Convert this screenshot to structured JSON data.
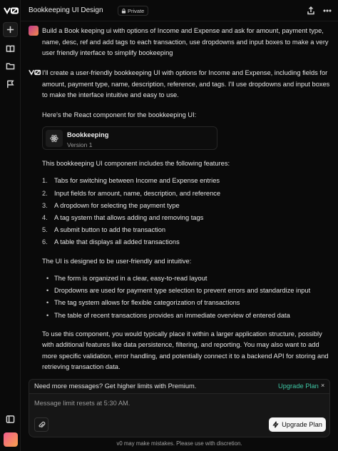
{
  "header": {
    "title": "Bookkeeping UI Design",
    "visibility": "Private"
  },
  "rail": {
    "logo": "v0",
    "icons": [
      "plus-icon",
      "book-icon",
      "folder-icon",
      "flag-icon",
      "sidebar-icon"
    ]
  },
  "conversation": {
    "user_message": "Build a Book keeping ui with options of Income and Expense and ask for amount, payment type, name, desc, ref and add tags to each transaction, use dropdowns and input boxes to make a very user friendly interface to simplify bookeeping",
    "assistant": {
      "intro": "I'll create a user-friendly bookkeeping UI with options for Income and Expense, including fields for amount, payment type, name, description, reference, and tags. I'll use dropdowns and input boxes to make the interface intuitive and easy to use.",
      "component_intro": "Here's the React component for the bookkeeping UI:",
      "card": {
        "title": "Bookkeeping",
        "version": "Version 1"
      },
      "features_intro": "This bookkeeping UI component includes the following features:",
      "features": [
        {
          "n": "1.",
          "text": "Tabs for switching between Income and Expense entries"
        },
        {
          "n": "2.",
          "text": "Input fields for amount, name, description, and reference"
        },
        {
          "n": "3.",
          "text": "A dropdown for selecting the payment type"
        },
        {
          "n": "4.",
          "text": "A tag system that allows adding and removing tags"
        },
        {
          "n": "5.",
          "text": "A submit button to add the transaction"
        },
        {
          "n": "6.",
          "text": "A table that displays all added transactions"
        }
      ],
      "design_intro": "The UI is designed to be user-friendly and intuitive:",
      "design_points": [
        "The form is organized in a clear, easy-to-read layout",
        "Dropdowns are used for payment type selection to prevent errors and standardize input",
        "The tag system allows for flexible categorization of transactions",
        "The table of recent transactions provides an immediate overview of entered data"
      ],
      "closing": "To use this component, you would typically place it within a larger application structure, possibly with additional features like data persistence, filtering, and reporting. You may also want to add more specific validation, error handling, and potentially connect it to a backend API for storing and retrieving transaction data."
    }
  },
  "banner": {
    "message": "Need more messages? Get higher limits with Premium.",
    "link": "Upgrade Plan",
    "close": "×"
  },
  "composer": {
    "placeholder": "Message limit resets at 5:30 AM.",
    "upgrade_button": "Upgrade Plan"
  },
  "disclaimer": "v0 may make mistakes. Please use with discretion.",
  "colors": {
    "accent": "#3fc7a5",
    "background": "#0a0a0a"
  }
}
